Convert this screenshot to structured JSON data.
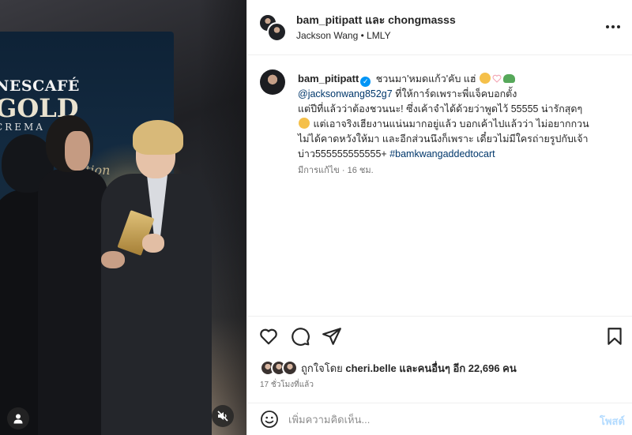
{
  "media": {
    "brand_line1": "NESCAFÉ",
    "brand_line2": "GOLD",
    "brand_line3": "CREMA",
    "script_text": "tion",
    "tag_icon": "user-tag-icon",
    "mute_icon": "speaker-muted-icon"
  },
  "header": {
    "user1": "bam_pitipatt",
    "joiner": "และ",
    "user2": "chongmasss",
    "subtitle": "Jackson Wang • LMLY",
    "more_icon": "more-horizontal-icon"
  },
  "caption": {
    "username": "bam_pitipatt",
    "line1_text": "ชวนมา'หมดแก้ว'คับ แฮ่",
    "mention": "@jacksonwang852g7",
    "line2_text": "ที่ให้การ์ดเพราะพี่แจ็คบอกตั้ง",
    "line3_text": "แต่ปีที่แล้วว่าต้องชวนนะ! ซึ่งเค้าจำได้ด้วยว่าพูดไว้ 55555 น่ารักสุดๆ",
    "line4_text": "แต่เอาจริงเฮียงานแน่นมากอยู่แล้ว บอกเค้าไปแล้วว่า ไม่อยากกวน",
    "line5_text": "ไม่ได้คาดหวังให้มา และอีกส่วนนึงก็เพราะ เดี๋ยวไม่มีใครถ่ายรูปกับเจ้า",
    "line6_text": "บ่าว555555555555+",
    "hashtag": "#bamkwangaddedtocart",
    "edited": "มีการแก้ไข",
    "dot": "·",
    "age": "16 ชม."
  },
  "actions": {
    "like_icon": "heart-icon",
    "comment_icon": "comment-icon",
    "share_icon": "send-icon",
    "save_icon": "bookmark-icon"
  },
  "likes": {
    "prefix": "ถูกใจโดย",
    "user": "cheri.belle",
    "and_others": "และคนอื่นๆ อีก 22,696 คน"
  },
  "timestamp": "17 ชั่วโมงที่แล้ว",
  "comment": {
    "placeholder": "เพิ่มความคิดเห็น...",
    "post_label": "โพสต์",
    "emoji_icon": "emoji-icon"
  },
  "colors": {
    "link": "#00376b",
    "verified": "#0095f6",
    "post_disabled": "#b3dbff",
    "secondary_text": "#737373"
  }
}
